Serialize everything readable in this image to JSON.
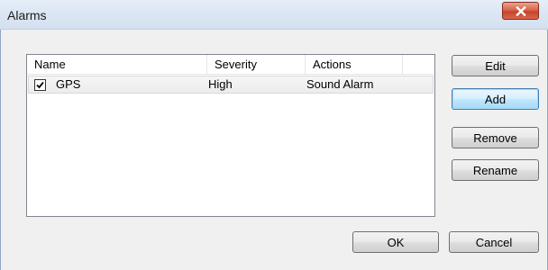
{
  "window": {
    "title": "Alarms"
  },
  "list": {
    "columns": [
      "Name",
      "Severity",
      "Actions"
    ],
    "rows": [
      {
        "checked": true,
        "name": "GPS",
        "severity": "High",
        "actions": "Sound Alarm"
      }
    ]
  },
  "side_buttons": {
    "edit": "Edit",
    "add": "Add",
    "remove": "Remove",
    "rename": "Rename"
  },
  "footer_buttons": {
    "ok": "OK",
    "cancel": "Cancel"
  },
  "icons": {
    "close": "close-icon",
    "check": "checkmark-icon"
  },
  "colors": {
    "close_button": "#c7442a",
    "default_button_border": "#3c7fb1"
  }
}
